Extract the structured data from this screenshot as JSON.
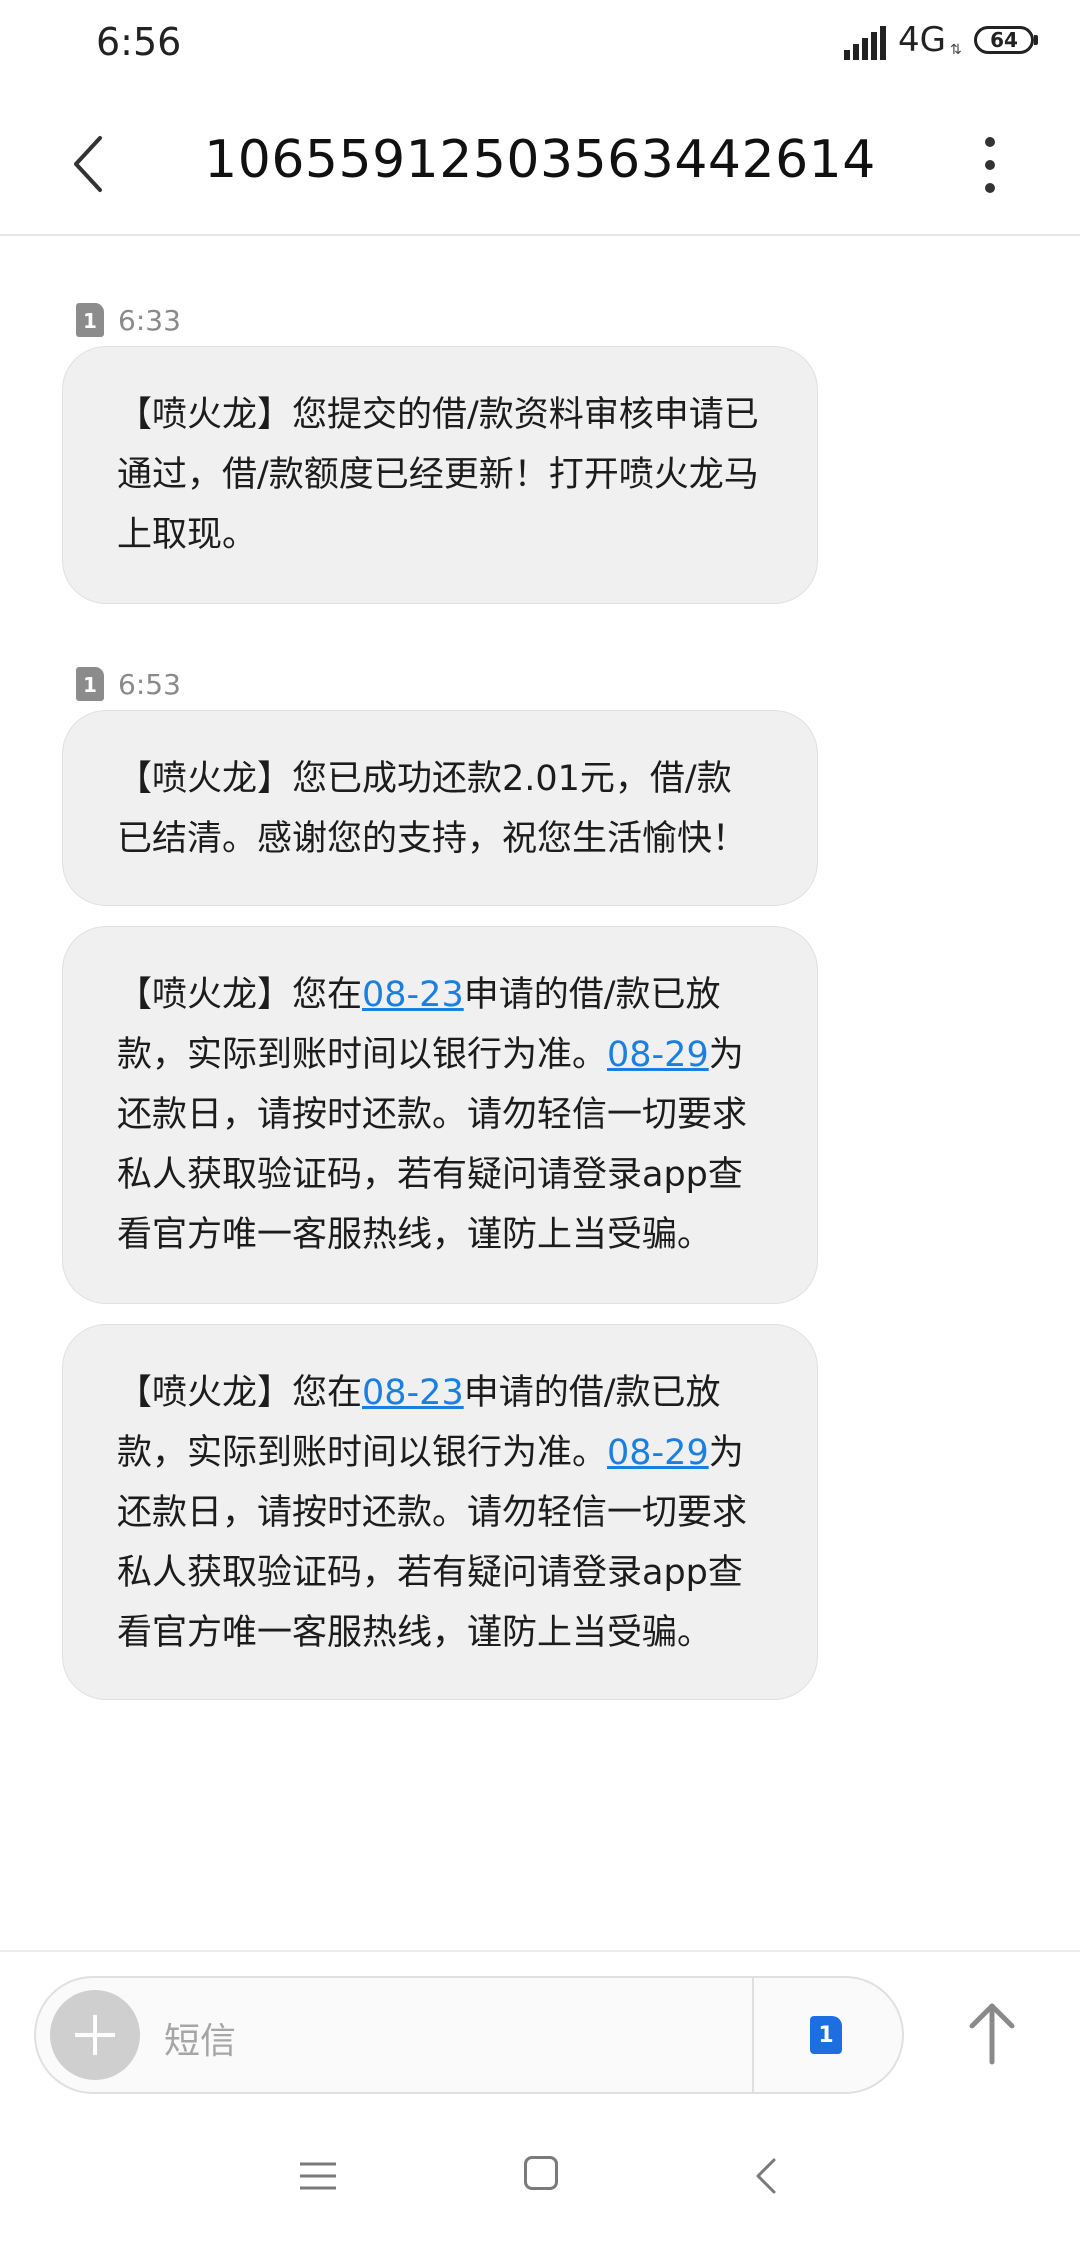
{
  "status_bar": {
    "time": "6:56",
    "network": "4G",
    "network_arrows": "⇅",
    "battery": "64"
  },
  "header": {
    "title": "10655912503563442614"
  },
  "messages": [
    {
      "sim": "1",
      "time": "6:33",
      "parts": [
        {
          "text": "【喷火龙】您提交的借/款资料审核申请已通过，借/款额度已经更新！打开喷火龙马上取现。"
        }
      ]
    },
    {
      "sim": "1",
      "time": "6:53",
      "parts": [
        {
          "text": "【喷火龙】您已成功还款2.01元，借/款已结清。感谢您的支持，祝您生活愉快！"
        }
      ]
    },
    {
      "parts": [
        {
          "text": "【喷火龙】您在"
        },
        {
          "text": "08-23",
          "link": true
        },
        {
          "text": "申请的借/款已放款，实际到账时间以银行为准。"
        },
        {
          "text": "08-29",
          "link": true
        },
        {
          "text": "为还款日，请按时还款。请勿轻信一切要求私人获取验证码，若有疑问请登录app查看官方唯一客服热线，谨防上当受骗。"
        }
      ]
    },
    {
      "parts": [
        {
          "text": "【喷火龙】您在"
        },
        {
          "text": "08-23",
          "link": true
        },
        {
          "text": "申请的借/款已放款，实际到账时间以银行为准。"
        },
        {
          "text": "08-29",
          "link": true
        },
        {
          "text": "为还款日，请按时还款。请勿轻信一切要求私人获取验证码，若有疑问请登录app查看官方唯一客服热线，谨防上当受骗。"
        }
      ]
    }
  ],
  "composer": {
    "placeholder": "短信",
    "sim": "1"
  },
  "colors": {
    "link": "#1a7fe0",
    "bubble": "#f0f0f0",
    "sim_badge": "#8c8c8c",
    "sim_select": "#1b6fe0"
  }
}
